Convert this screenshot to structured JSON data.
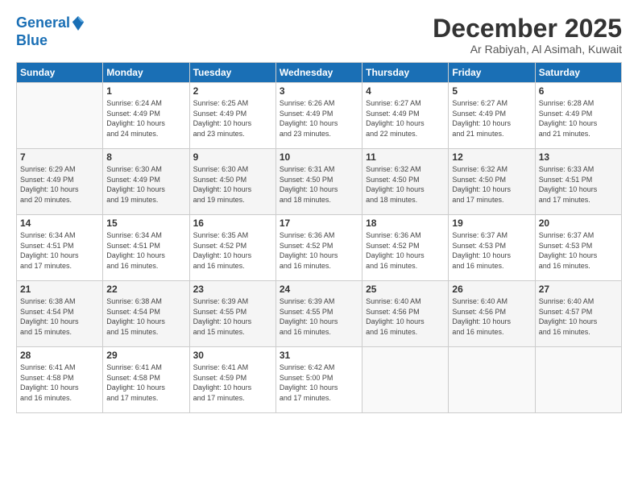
{
  "header": {
    "logo_line1": "General",
    "logo_line2": "Blue",
    "month": "December 2025",
    "location": "Ar Rabiyah, Al Asimah, Kuwait"
  },
  "days_of_week": [
    "Sunday",
    "Monday",
    "Tuesday",
    "Wednesday",
    "Thursday",
    "Friday",
    "Saturday"
  ],
  "weeks": [
    [
      {
        "day": "",
        "info": ""
      },
      {
        "day": "1",
        "info": "Sunrise: 6:24 AM\nSunset: 4:49 PM\nDaylight: 10 hours\nand 24 minutes."
      },
      {
        "day": "2",
        "info": "Sunrise: 6:25 AM\nSunset: 4:49 PM\nDaylight: 10 hours\nand 23 minutes."
      },
      {
        "day": "3",
        "info": "Sunrise: 6:26 AM\nSunset: 4:49 PM\nDaylight: 10 hours\nand 23 minutes."
      },
      {
        "day": "4",
        "info": "Sunrise: 6:27 AM\nSunset: 4:49 PM\nDaylight: 10 hours\nand 22 minutes."
      },
      {
        "day": "5",
        "info": "Sunrise: 6:27 AM\nSunset: 4:49 PM\nDaylight: 10 hours\nand 21 minutes."
      },
      {
        "day": "6",
        "info": "Sunrise: 6:28 AM\nSunset: 4:49 PM\nDaylight: 10 hours\nand 21 minutes."
      }
    ],
    [
      {
        "day": "7",
        "info": "Sunrise: 6:29 AM\nSunset: 4:49 PM\nDaylight: 10 hours\nand 20 minutes."
      },
      {
        "day": "8",
        "info": "Sunrise: 6:30 AM\nSunset: 4:49 PM\nDaylight: 10 hours\nand 19 minutes."
      },
      {
        "day": "9",
        "info": "Sunrise: 6:30 AM\nSunset: 4:50 PM\nDaylight: 10 hours\nand 19 minutes."
      },
      {
        "day": "10",
        "info": "Sunrise: 6:31 AM\nSunset: 4:50 PM\nDaylight: 10 hours\nand 18 minutes."
      },
      {
        "day": "11",
        "info": "Sunrise: 6:32 AM\nSunset: 4:50 PM\nDaylight: 10 hours\nand 18 minutes."
      },
      {
        "day": "12",
        "info": "Sunrise: 6:32 AM\nSunset: 4:50 PM\nDaylight: 10 hours\nand 17 minutes."
      },
      {
        "day": "13",
        "info": "Sunrise: 6:33 AM\nSunset: 4:51 PM\nDaylight: 10 hours\nand 17 minutes."
      }
    ],
    [
      {
        "day": "14",
        "info": "Sunrise: 6:34 AM\nSunset: 4:51 PM\nDaylight: 10 hours\nand 17 minutes."
      },
      {
        "day": "15",
        "info": "Sunrise: 6:34 AM\nSunset: 4:51 PM\nDaylight: 10 hours\nand 16 minutes."
      },
      {
        "day": "16",
        "info": "Sunrise: 6:35 AM\nSunset: 4:52 PM\nDaylight: 10 hours\nand 16 minutes."
      },
      {
        "day": "17",
        "info": "Sunrise: 6:36 AM\nSunset: 4:52 PM\nDaylight: 10 hours\nand 16 minutes."
      },
      {
        "day": "18",
        "info": "Sunrise: 6:36 AM\nSunset: 4:52 PM\nDaylight: 10 hours\nand 16 minutes."
      },
      {
        "day": "19",
        "info": "Sunrise: 6:37 AM\nSunset: 4:53 PM\nDaylight: 10 hours\nand 16 minutes."
      },
      {
        "day": "20",
        "info": "Sunrise: 6:37 AM\nSunset: 4:53 PM\nDaylight: 10 hours\nand 16 minutes."
      }
    ],
    [
      {
        "day": "21",
        "info": "Sunrise: 6:38 AM\nSunset: 4:54 PM\nDaylight: 10 hours\nand 15 minutes."
      },
      {
        "day": "22",
        "info": "Sunrise: 6:38 AM\nSunset: 4:54 PM\nDaylight: 10 hours\nand 15 minutes."
      },
      {
        "day": "23",
        "info": "Sunrise: 6:39 AM\nSunset: 4:55 PM\nDaylight: 10 hours\nand 15 minutes."
      },
      {
        "day": "24",
        "info": "Sunrise: 6:39 AM\nSunset: 4:55 PM\nDaylight: 10 hours\nand 16 minutes."
      },
      {
        "day": "25",
        "info": "Sunrise: 6:40 AM\nSunset: 4:56 PM\nDaylight: 10 hours\nand 16 minutes."
      },
      {
        "day": "26",
        "info": "Sunrise: 6:40 AM\nSunset: 4:56 PM\nDaylight: 10 hours\nand 16 minutes."
      },
      {
        "day": "27",
        "info": "Sunrise: 6:40 AM\nSunset: 4:57 PM\nDaylight: 10 hours\nand 16 minutes."
      }
    ],
    [
      {
        "day": "28",
        "info": "Sunrise: 6:41 AM\nSunset: 4:58 PM\nDaylight: 10 hours\nand 16 minutes."
      },
      {
        "day": "29",
        "info": "Sunrise: 6:41 AM\nSunset: 4:58 PM\nDaylight: 10 hours\nand 17 minutes."
      },
      {
        "day": "30",
        "info": "Sunrise: 6:41 AM\nSunset: 4:59 PM\nDaylight: 10 hours\nand 17 minutes."
      },
      {
        "day": "31",
        "info": "Sunrise: 6:42 AM\nSunset: 5:00 PM\nDaylight: 10 hours\nand 17 minutes."
      },
      {
        "day": "",
        "info": ""
      },
      {
        "day": "",
        "info": ""
      },
      {
        "day": "",
        "info": ""
      }
    ]
  ]
}
